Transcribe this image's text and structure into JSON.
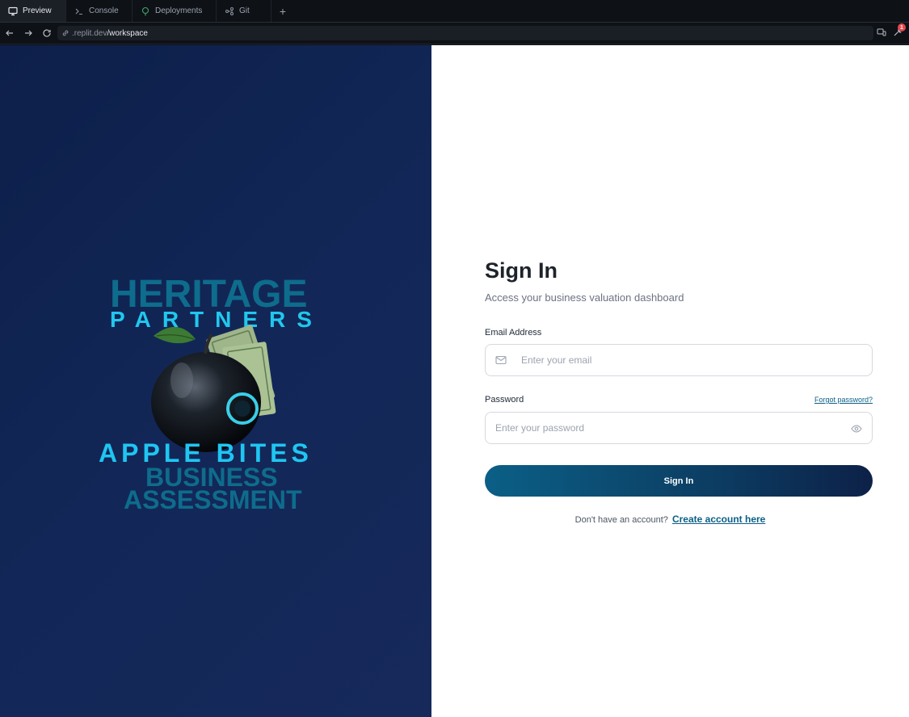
{
  "tabs": [
    {
      "label": "Preview",
      "icon": "monitor-icon",
      "active": true
    },
    {
      "label": "Console",
      "icon": "terminal-icon",
      "active": false
    },
    {
      "label": "Deployments",
      "icon": "deploy-icon",
      "active": false
    },
    {
      "label": "Git",
      "icon": "git-icon",
      "active": false
    }
  ],
  "urlbar": {
    "host": ".replit.dev",
    "path": "/workspace",
    "notification_count": "1"
  },
  "brand": {
    "line1": "HERITAGE",
    "line2": "PARTNERS",
    "tagline1": "APPLE BITES",
    "tagline2": "BUSINESS",
    "tagline3": "ASSESSMENT"
  },
  "form": {
    "title": "Sign In",
    "subtitle": "Access your business valuation dashboard",
    "email_label": "Email Address",
    "email_placeholder": "Enter your email",
    "password_label": "Password",
    "forgot_label": "Forgot password?",
    "password_placeholder": "Enter your password",
    "submit_label": "Sign In",
    "signup_prompt": "Don't have an account?",
    "signup_link": "Create account here"
  },
  "colors": {
    "accent": "#0b5f86",
    "hero_bg": "#122757",
    "brand_cyan": "#21c7ee",
    "brand_teal": "#0e6c8c"
  }
}
